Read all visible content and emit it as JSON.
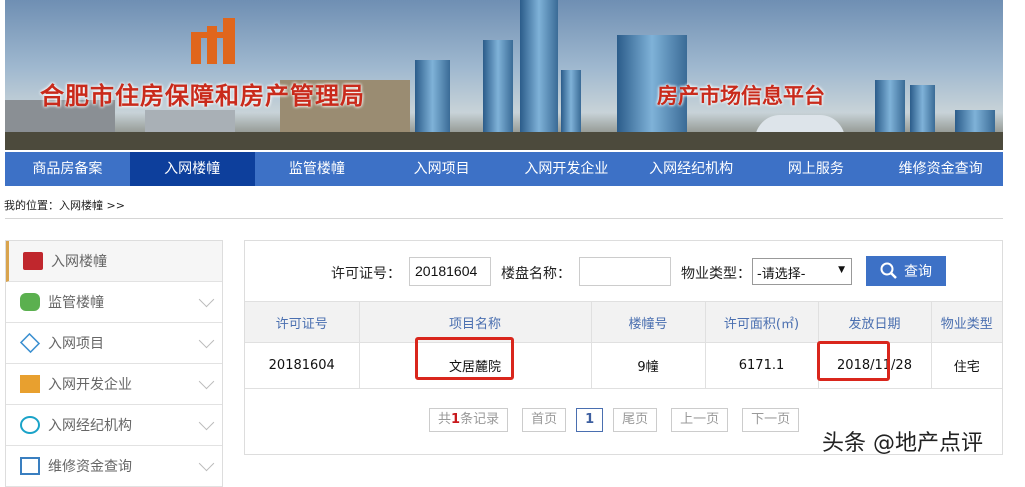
{
  "header": {
    "title_left": "合肥市住房保障和房产管理局",
    "title_right": "房产市场信息平台"
  },
  "nav": [
    "商品房备案",
    "入网楼幢",
    "监管楼幢",
    "入网项目",
    "入网开发企业",
    "入网经纪机构",
    "网上服务",
    "维修资金查询"
  ],
  "breadcrumb": "我的位置：入网楼幢 >>",
  "sidebar": [
    {
      "label": "入网楼幢",
      "icon": "building-icon",
      "color": "#c0272d"
    },
    {
      "label": "监管楼幢",
      "icon": "coins-icon",
      "color": "#4caf50"
    },
    {
      "label": "入网项目",
      "icon": "layers-icon",
      "color": "#3a8fd0"
    },
    {
      "label": "入网开发企业",
      "icon": "office-icon",
      "color": "#e8a02f"
    },
    {
      "label": "入网经纪机构",
      "icon": "agency-icon",
      "color": "#1aa3c8"
    },
    {
      "label": "维修资金查询",
      "icon": "box-icon",
      "color": "#3a7fc0"
    }
  ],
  "search": {
    "permit_label": "许可证号：",
    "permit_value": "20181604",
    "name_label": "楼盘名称：",
    "name_value": "",
    "type_label": "物业类型：",
    "type_value": "-请选择-",
    "button": "查询"
  },
  "table": {
    "headers": [
      "许可证号",
      "项目名称",
      "楼幢号",
      "许可面积(㎡)",
      "发放日期",
      "物业类型"
    ],
    "rows": [
      [
        "20181604",
        "文居麓院",
        "9幢",
        "6171.1",
        "2018/11/28",
        "住宅"
      ]
    ]
  },
  "pager": {
    "prefix": "共",
    "count": "1",
    "suffix": "条记录",
    "first": "首页",
    "current": "1",
    "last": "尾页",
    "prev": "上一页",
    "next": "下一页"
  },
  "watermark": "头条 @地产点评"
}
